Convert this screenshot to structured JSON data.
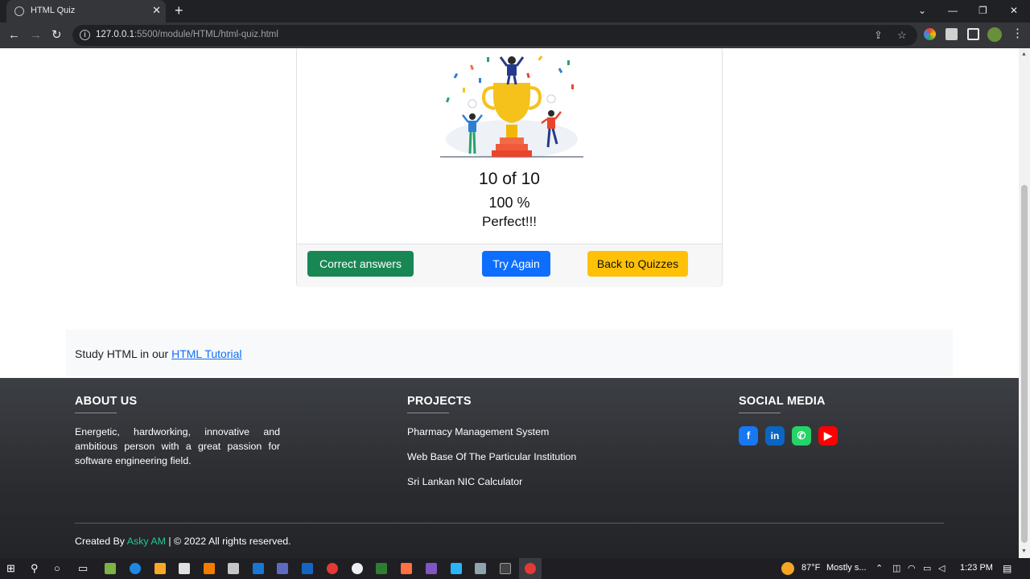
{
  "browser": {
    "tab_title": "HTML Quiz",
    "tab_close": "✕",
    "new_tab": "+",
    "url_host": "127.0.0.1",
    "url_path": ":5500/module/HTML/html-quiz.html",
    "window_controls": {
      "tabs_dropdown": "⌄",
      "minimize": "—",
      "restore": "❐",
      "close": "✕"
    }
  },
  "quiz_result": {
    "score": "10 of 10",
    "percent": "100 %",
    "remark": "Perfect!!!",
    "buttons": {
      "correct_answers": "Correct answers",
      "try_again": "Try Again",
      "back_to_quizzes": "Back to Quizzes"
    }
  },
  "study": {
    "prefix": "Study HTML in our ",
    "link": "HTML Tutorial"
  },
  "footer": {
    "about": {
      "heading": "ABOUT US",
      "text": "Energetic, hardworking, innovative and ambitious person with a great passion for software engineering field."
    },
    "projects": {
      "heading": "PROJECTS",
      "items": [
        "Pharmacy Management System",
        "Web Base Of The Particular Institution",
        "Sri Lankan NIC Calculator"
      ]
    },
    "social": {
      "heading": "SOCIAL MEDIA",
      "icons": [
        "facebook-icon",
        "linkedin-icon",
        "whatsapp-icon",
        "youtube-icon"
      ],
      "linkedin_label": "in"
    },
    "copyright": {
      "prefix": "Created By ",
      "author": "Asky AM",
      "suffix": " | © 2022 All rights reserved."
    }
  },
  "taskbar": {
    "temperature": "87°F",
    "weather": "Mostly s...",
    "time": "1:23 PM"
  },
  "colors": {
    "success": "#198754",
    "primary": "#0d6efd",
    "warning": "#ffc107",
    "author": "#20c997",
    "footer_bg": "#2b2c30"
  }
}
